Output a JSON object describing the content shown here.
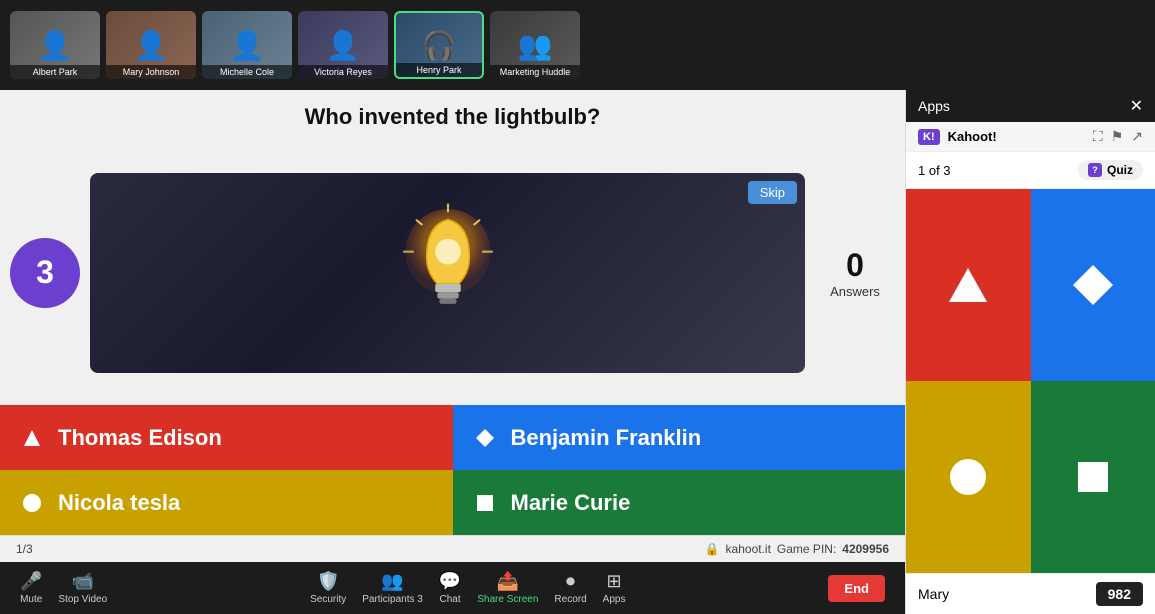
{
  "topBar": {
    "participants": [
      {
        "id": "albert",
        "name": "Albert Park",
        "active": false,
        "bgClass": "albert-bg"
      },
      {
        "id": "mary",
        "name": "Mary Johnson",
        "active": false,
        "bgClass": "mary-bg"
      },
      {
        "id": "michelle",
        "name": "Michelle Cole",
        "active": false,
        "bgClass": "michelle-bg"
      },
      {
        "id": "victoria",
        "name": "Victoria Reyes",
        "active": false,
        "bgClass": "victoria-bg"
      },
      {
        "id": "henry",
        "name": "Henry Park",
        "active": true,
        "bgClass": "henry-bg"
      },
      {
        "id": "marketing",
        "name": "Marketing Huddle",
        "active": false,
        "bgClass": "marketing-bg"
      }
    ]
  },
  "question": {
    "text": "Who invented the lightbulb?",
    "timer": "3",
    "answersCount": "0",
    "answersLabel": "Answers",
    "skipLabel": "Skip"
  },
  "answers": [
    {
      "id": "a1",
      "text": "Thomas Edison",
      "color": "red",
      "shape": "triangle"
    },
    {
      "id": "a2",
      "text": "Benjamin Franklin",
      "color": "blue",
      "shape": "diamond"
    },
    {
      "id": "a3",
      "text": "Nicola tesla",
      "color": "yellow",
      "shape": "circle"
    },
    {
      "id": "a4",
      "text": "Marie Curie",
      "color": "green",
      "shape": "square"
    }
  ],
  "statusBar": {
    "pageNum": "1/3",
    "gamePinLabel": "kahoot.it",
    "gamePinText": "Game PIN:",
    "gamePin": "4209956"
  },
  "toolbar": {
    "items": [
      {
        "id": "mute",
        "icon": "🎤",
        "label": "Mute"
      },
      {
        "id": "stop-video",
        "icon": "📹",
        "label": "Stop Video"
      },
      {
        "id": "security",
        "icon": "🔒",
        "label": "Security"
      },
      {
        "id": "participants",
        "icon": "👥",
        "label": "Participants",
        "badge": "3"
      },
      {
        "id": "chat",
        "icon": "💬",
        "label": "Chat"
      },
      {
        "id": "share-screen",
        "icon": "📤",
        "label": "Share Screen",
        "active": true
      },
      {
        "id": "record",
        "icon": "⏺",
        "label": "Record"
      },
      {
        "id": "apps",
        "icon": "⊞",
        "label": "Apps"
      }
    ],
    "endLabel": "End"
  },
  "rightPanel": {
    "title": "Apps",
    "kahootName": "Kahoot!",
    "quizCounter": "1 of 3",
    "quizBadge": "Quiz",
    "colorGrid": [
      {
        "id": "rg1",
        "colorClass": "red-cell",
        "shape": "triangle"
      },
      {
        "id": "rg2",
        "colorClass": "blue-cell",
        "shape": "diamond"
      },
      {
        "id": "rg3",
        "colorClass": "yellow-cell",
        "shape": "circle"
      },
      {
        "id": "rg4",
        "colorClass": "green-cell",
        "shape": "square"
      }
    ],
    "userName": "Mary",
    "userScore": "982"
  }
}
